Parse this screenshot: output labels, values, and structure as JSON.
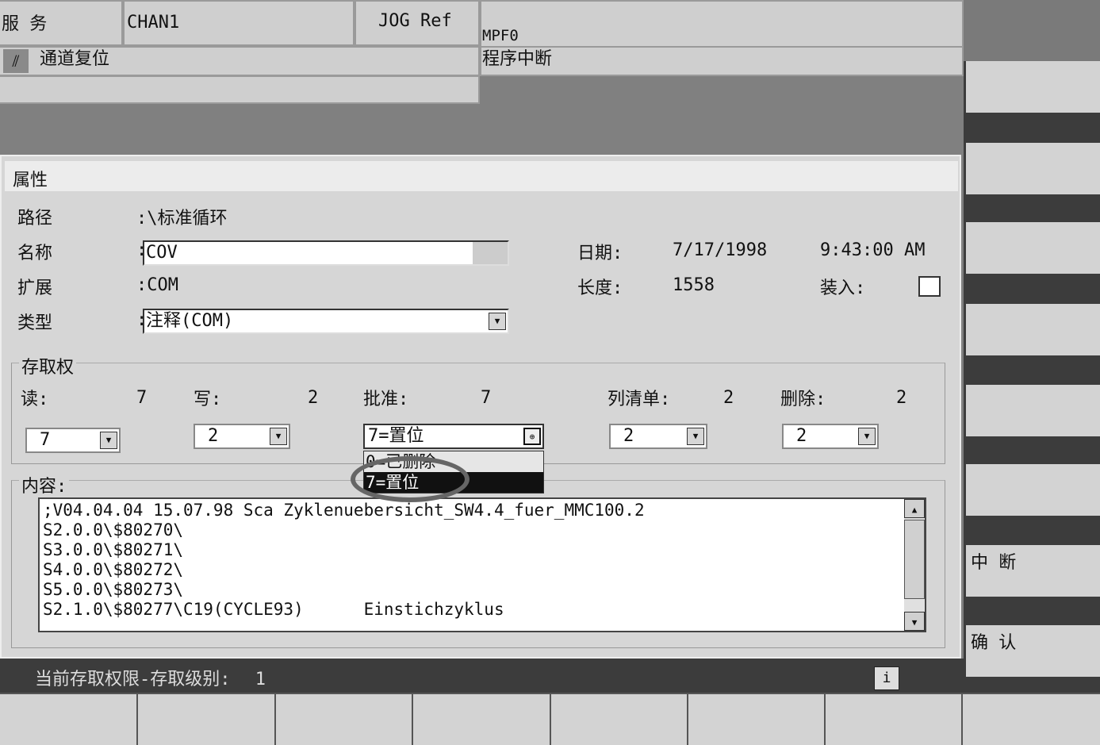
{
  "header": {
    "area": "服 务",
    "channel": "CHAN1",
    "mode": "JOG Ref",
    "program": "MPF0",
    "channel_status": "通道复位",
    "program_status": "程序中断"
  },
  "properties": {
    "title": "属性",
    "path_label": "路径",
    "path_value": ":\\标准循环",
    "name_label": "名称",
    "name_value": "COV",
    "ext_label": "扩展",
    "ext_value": ":COM",
    "type_label": "类型",
    "type_value": "注释(COM)",
    "date_label": "日期:",
    "date_value": "7/17/1998",
    "time_value": "9:43:00 AM",
    "length_label": "长度:",
    "length_value": "1558",
    "load_label": "装入:"
  },
  "access": {
    "title": "存取权",
    "read_label": "读:",
    "read_value": "7",
    "write_label": "写:",
    "write_value": "2",
    "approve_label": "批准:",
    "approve_value": "7",
    "list_label": "列清单:",
    "list_value": "2",
    "delete_label": "删除:",
    "delete_value": "2",
    "read_select": "7",
    "write_select": "2",
    "approve_select": "7=置位",
    "list_select": "2",
    "delete_select": "2",
    "approve_options": [
      "0=已删除",
      "7=置位"
    ]
  },
  "content": {
    "title": "内容:",
    "lines": [
      ";V04.04.04 15.07.98 Sca Zyklenuebersicht_SW4.4_fuer_MMC100.2",
      "S2.0.0\\$80270\\",
      "S3.0.0\\$80271\\",
      "S4.0.0\\$80272\\",
      "S5.0.0\\$80273\\",
      "S2.1.0\\$80277\\C19(CYCLE93)      Einstichzyklus"
    ]
  },
  "status": {
    "text": "当前存取权限-存取级别:",
    "level": "1",
    "info": "i"
  },
  "softkeys": [
    "",
    "",
    "",
    "",
    "",
    "",
    "中 断",
    "确 认"
  ]
}
